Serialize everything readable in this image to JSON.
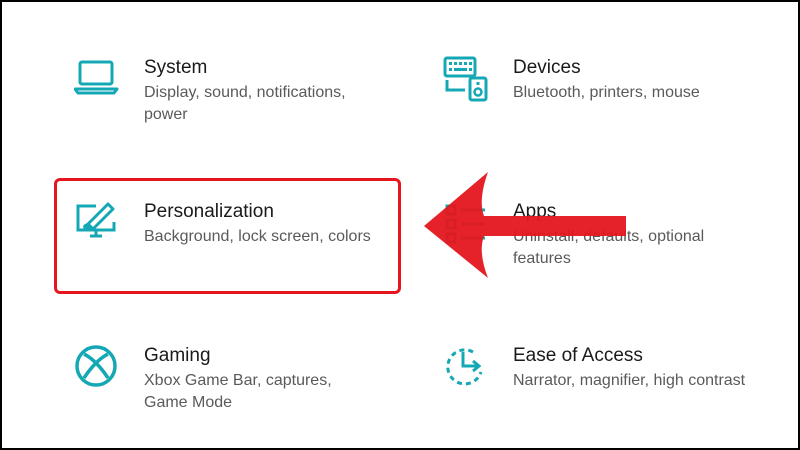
{
  "settings": {
    "tiles": [
      {
        "icon": "laptop-icon",
        "title": "System",
        "description": "Display, sound, notifications, power"
      },
      {
        "icon": "devices-icon",
        "title": "Devices",
        "description": "Bluetooth, printers, mouse"
      },
      {
        "icon": "personalization-icon",
        "title": "Personalization",
        "description": "Background, lock screen, colors"
      },
      {
        "icon": "apps-icon",
        "title": "Apps",
        "description": "Uninstall, defaults, optional features"
      },
      {
        "icon": "xbox-icon",
        "title": "Gaming",
        "description": "Xbox Game Bar, captures, Game Mode"
      },
      {
        "icon": "ease-of-access-icon",
        "title": "Ease of Access",
        "description": "Narrator, magnifier, high contrast"
      }
    ]
  },
  "colors": {
    "accent": "#14a8b4",
    "highlight": "#e4161e",
    "title_text": "#1a1a1a",
    "description_text": "#5a5a5a"
  }
}
